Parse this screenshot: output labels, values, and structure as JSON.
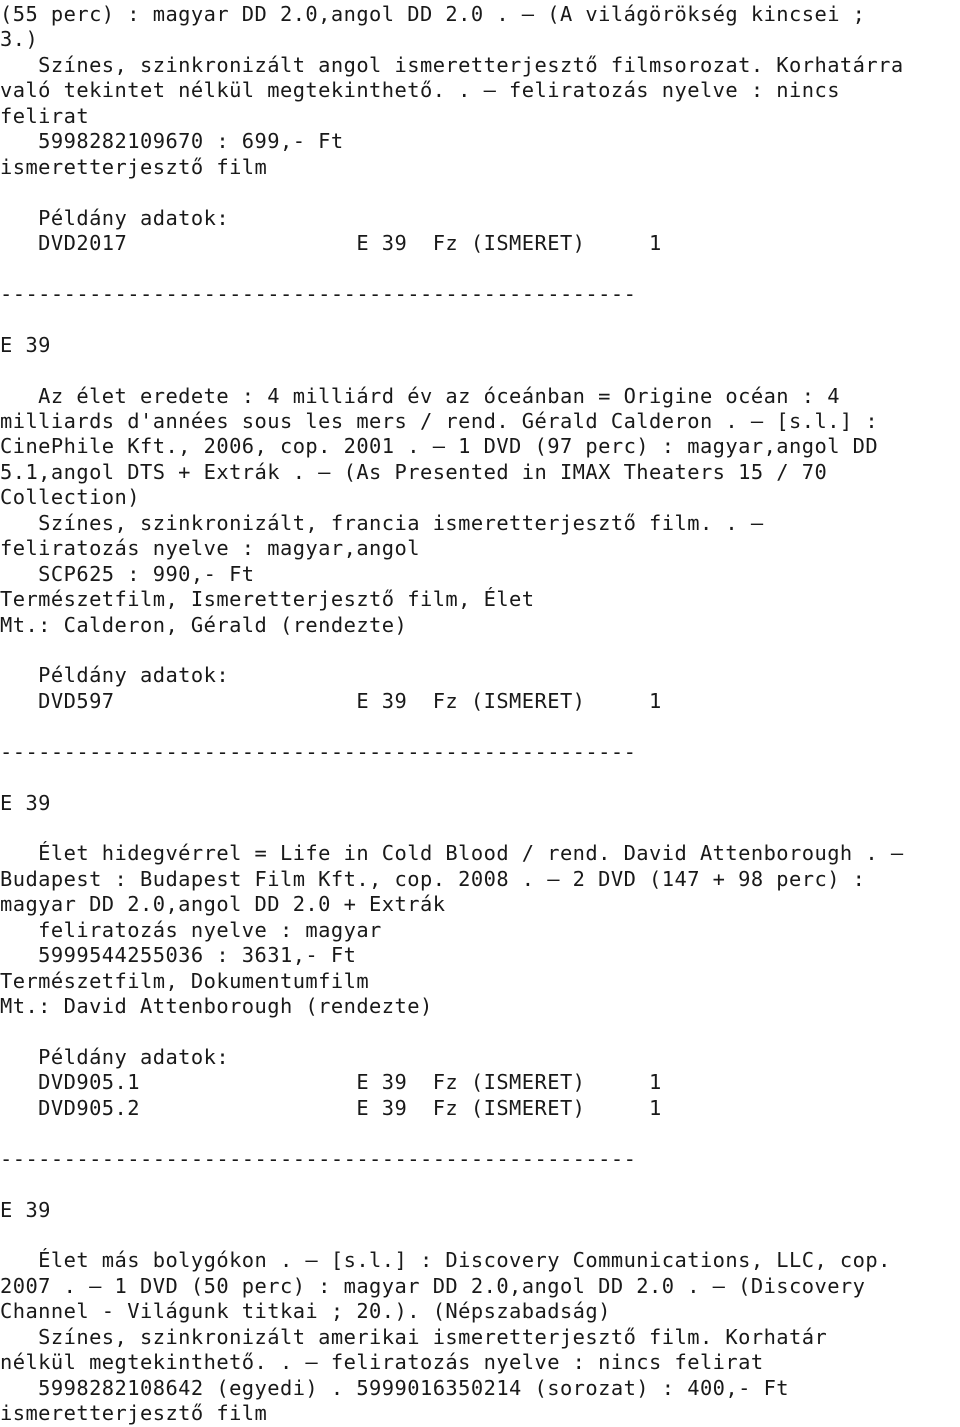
{
  "document": {
    "kind": "library-catalog-printout",
    "language": "hu",
    "separator": "--------------------------------------------------",
    "copy_block_label": "Példány adatok:",
    "lines": [
      "(55 perc) : magyar DD 2.0,angol DD 2.0 . — (A világörökség kincsei ;",
      "3.)",
      "   Színes, szinkronizált angol ismeretterjesztő filmsorozat. Korhatárra",
      "való tekintet nélkül megtekinthető. . — feliratozás nyelve : nincs",
      "felirat",
      "   5998282109670 : 699,- Ft",
      "ismeretterjesztő film",
      "",
      "   Példány adatok:",
      "   DVD2017                  E 39  Fz (ISMERET)     1",
      "",
      "--------------------------------------------------",
      "",
      "E 39",
      "",
      "   Az élet eredete : 4 milliárd év az óceánban = Origine océan : 4",
      "milliards d'années sous les mers / rend. Gérald Calderon . — [s.l.] :",
      "CinePhile Kft., 2006, cop. 2001 . — 1 DVD (97 perc) : magyar,angol DD",
      "5.1,angol DTS + Extrák . — (As Presented in IMAX Theaters 15 / 70",
      "Collection)",
      "   Színes, szinkronizált, francia ismeretterjesztő film. . —",
      "feliratozás nyelve : magyar,angol",
      "   SCP625 : 990,- Ft",
      "Természetfilm, Ismeretterjesztő film, Élet",
      "Mt.: Calderon, Gérald (rendezte)",
      "",
      "   Példány adatok:",
      "   DVD597                   E 39  Fz (ISMERET)     1",
      "",
      "--------------------------------------------------",
      "",
      "E 39",
      "",
      "   Élet hidegvérrel = Life in Cold Blood / rend. David Attenborough . —",
      "Budapest : Budapest Film Kft., cop. 2008 . — 2 DVD (147 + 98 perc) :",
      "magyar DD 2.0,angol DD 2.0 + Extrák",
      "   feliratozás nyelve : magyar",
      "   5999544255036 : 3631,- Ft",
      "Természetfilm, Dokumentumfilm",
      "Mt.: David Attenborough (rendezte)",
      "",
      "   Példány adatok:",
      "   DVD905.1                 E 39  Fz (ISMERET)     1",
      "   DVD905.2                 E 39  Fz (ISMERET)     1",
      "",
      "--------------------------------------------------",
      "",
      "E 39",
      "",
      "   Élet más bolygókon . — [s.l.] : Discovery Communications, LLC, cop.",
      "2007 . — 1 DVD (50 perc) : magyar DD 2.0,angol DD 2.0 . — (Discovery",
      "Channel - Világunk titkai ; 20.). (Népszabadság)",
      "   Színes, szinkronizált amerikai ismeretterjesztő film. Korhatár",
      "nélkül megtekinthető. . — feliratozás nyelve : nincs felirat",
      "   5998282108642 (egyedi) . 5999016350214 (sorozat) : 400,- Ft",
      "ismeretterjesztő film"
    ],
    "records": [
      {
        "shelf_mark": "E 39",
        "title_continuation": "(55 perc) : magyar DD 2.0,angol DD 2.0 . — (A világörökség kincsei ; 3.)",
        "series": "A világörökség kincsei ; 3.",
        "duration": "55 perc",
        "audio": "magyar DD 2.0,angol DD 2.0",
        "description": "Színes, szinkronizált angol ismeretterjesztő filmsorozat. Korhatárra való tekintet nélkül megtekinthető.",
        "subtitles_label": "feliratozás nyelve",
        "subtitles": "nincs felirat",
        "isbn": "5998282109670",
        "price": "699,- Ft",
        "genre": "ismeretterjesztő film",
        "copies": [
          {
            "call_number": "DVD2017",
            "shelf": "E 39",
            "binding": "Fz",
            "collection": "(ISMERET)",
            "count": "1"
          }
        ]
      },
      {
        "shelf_mark": "E 39",
        "title": "Az élet eredete : 4 milliárd év az óceánban = Origine océan : 4 milliards d'années sous les mers",
        "responsibility": "rend. Gérald Calderon",
        "place": "[s.l.]",
        "publisher": "CinePhile Kft.",
        "year": "2006, cop. 2001",
        "extent": "1 DVD (97 perc)",
        "audio": "magyar,angol DD 5.1,angol DTS + Extrák",
        "series": "As Presented in IMAX Theaters 15 / 70 Collection",
        "description": "Színes, szinkronizált, francia ismeretterjesztő film.",
        "subtitles_label": "feliratozás nyelve",
        "subtitles": "magyar,angol",
        "isbn": "SCP625",
        "price": "990,- Ft",
        "genre": "Természetfilm, Ismeretterjesztő film, Élet",
        "added_entry": "Mt.: Calderon, Gérald (rendezte)",
        "copies": [
          {
            "call_number": "DVD597",
            "shelf": "E 39",
            "binding": "Fz",
            "collection": "(ISMERET)",
            "count": "1"
          }
        ]
      },
      {
        "shelf_mark": "E 39",
        "title": "Élet hidegvérrel = Life in Cold Blood",
        "responsibility": "rend. David Attenborough",
        "place": "Budapest",
        "publisher": "Budapest Film Kft.",
        "year": "cop. 2008",
        "extent": "2 DVD (147 + 98 perc)",
        "audio": "magyar DD 2.0,angol DD 2.0 + Extrák",
        "subtitles_label": "feliratozás nyelve",
        "subtitles": "magyar",
        "isbn": "5999544255036",
        "price": "3631,- Ft",
        "genre": "Természetfilm, Dokumentumfilm",
        "added_entry": "Mt.: David Attenborough (rendezte)",
        "copies": [
          {
            "call_number": "DVD905.1",
            "shelf": "E 39",
            "binding": "Fz",
            "collection": "(ISMERET)",
            "count": "1"
          },
          {
            "call_number": "DVD905.2",
            "shelf": "E 39",
            "binding": "Fz",
            "collection": "(ISMERET)",
            "count": "1"
          }
        ]
      },
      {
        "shelf_mark": "E 39",
        "title": "Élet más bolygókon",
        "place": "[s.l.]",
        "publisher": "Discovery Communications, LLC",
        "year": "cop. 2007",
        "extent": "1 DVD (50 perc)",
        "audio": "magyar DD 2.0,angol DD 2.0",
        "series": "Discovery Channel - Világunk titkai ; 20.). (Népszabadság)",
        "description": "Színes, szinkronizált amerikai ismeretterjesztő film. Korhatár nélkül megtekinthető.",
        "subtitles_label": "feliratozás nyelve",
        "subtitles": "nincs felirat",
        "isbn": "5998282108642 (egyedi) . 5999016350214 (sorozat)",
        "price": "400,- Ft",
        "genre": "ismeretterjesztő film",
        "copies": []
      }
    ]
  }
}
